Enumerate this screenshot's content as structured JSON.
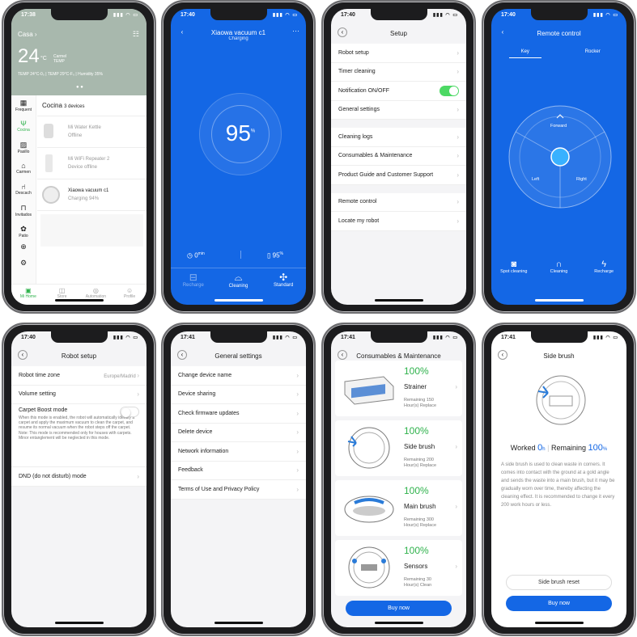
{
  "p1": {
    "time": "17:38",
    "home": "Casa",
    "temp": "24",
    "temp_unit": "°C",
    "loc": "Carmel",
    "loc2": "TEMP",
    "metrics": "TEMP 24°C-0₀ | TEMP 29°C-F₀ | Humidity 35%",
    "side": [
      {
        "label": "Frequent"
      },
      {
        "label": "Cocina"
      },
      {
        "label": "Pasillo"
      },
      {
        "label": "Carmen"
      },
      {
        "label": "Descach"
      },
      {
        "label": "Invitados"
      },
      {
        "label": "Patio"
      }
    ],
    "room": "Cocina",
    "count": "3 devices",
    "devices": [
      {
        "name": "Mi Water Kettle",
        "status": "Offline"
      },
      {
        "name": "Mi WiFi Repeater 2",
        "status": "Device offline"
      },
      {
        "name": "Xiaowa  vacuum c1",
        "status": "Charging    94%"
      }
    ],
    "tabs": [
      "Mi Home",
      "Store",
      "Automation",
      "Profile"
    ]
  },
  "p2": {
    "time": "17:40",
    "title": "Xiaowa  vacuum c1",
    "sub": "Charging",
    "pct": "95",
    "unit": "%",
    "time_val": "0",
    "time_unit": "min",
    "batt": "95",
    "batt_unit": "%",
    "actions": [
      "Recharge",
      "Cleaning",
      "Standard"
    ]
  },
  "p3": {
    "time": "17:40",
    "title": "Setup",
    "g1": [
      "Robot setup",
      "Timer cleaning",
      "Notification ON/OFF",
      "General settings"
    ],
    "g2": [
      "Cleaning logs",
      "Consumables & Maintenance",
      "Product Guide and Customer Support"
    ],
    "g3": [
      "Remote control",
      "Locate my robot"
    ]
  },
  "p4": {
    "time": "17:40",
    "title": "Remote control",
    "tabs": [
      "Key",
      "Rocker"
    ],
    "dirs": [
      "Forward",
      "Left",
      "Right"
    ],
    "actions": [
      "Spot cleaning",
      "Cleaning",
      "Recharge"
    ]
  },
  "p5": {
    "time": "17:40",
    "title": "Robot setup",
    "tz_label": "Robot time zone",
    "tz_value": "Europe/Madrid",
    "volume": "Volume setting",
    "carpet": "Carpet Boost mode",
    "carpet_desc": "When this mode is enabled, the robot will automatically identify a carpet and apply the maximum vacuum to clean the carpet, and resume its normal vacuum when the robot steps off the carpet. Note: This mode is recommended only for houses with carpets. Minor entanglement will be neglected in this mode.",
    "dnd": "DND (do not disturb) mode"
  },
  "p6": {
    "time": "17:41",
    "title": "General settings",
    "items": [
      "Change device name",
      "Device sharing",
      "Check firmware updates",
      "Delete device",
      "Network information",
      "Feedback",
      "Terms of Use and Privacy Policy"
    ]
  },
  "p7": {
    "time": "17:41",
    "title": "Consumables & Maintenance",
    "cards": [
      {
        "pct": "100%",
        "name": "Strainer",
        "r1": "Remaining 150",
        "r2": "Hour(s) Replace"
      },
      {
        "pct": "100%",
        "name": "Side brush",
        "r1": "Remaining 200",
        "r2": "Hour(s) Replace"
      },
      {
        "pct": "100%",
        "name": "Main brush",
        "r1": "Remaining 300",
        "r2": "Hour(s) Replace"
      },
      {
        "pct": "100%",
        "name": "Sensors",
        "r1": "Remaining 30",
        "r2": "Hour(s) Clean"
      }
    ],
    "buy": "Buy now"
  },
  "p8": {
    "time": "17:41",
    "title": "Side brush",
    "worked": "Worked",
    "worked_val": "0",
    "worked_unit": "h",
    "remaining": "Remaining",
    "remaining_val": "100",
    "remaining_unit": "%",
    "desc": "A side brush is used to clean waste in corners. It comes into contact with the ground at a gold angle and sends the waste into a main brush, but it may be gradually worn over time, thereby affecting the cleaning effect. It is recommended to change it every 200 work hours or less.",
    "reset": "Side brush reset",
    "buy": "Buy now"
  }
}
